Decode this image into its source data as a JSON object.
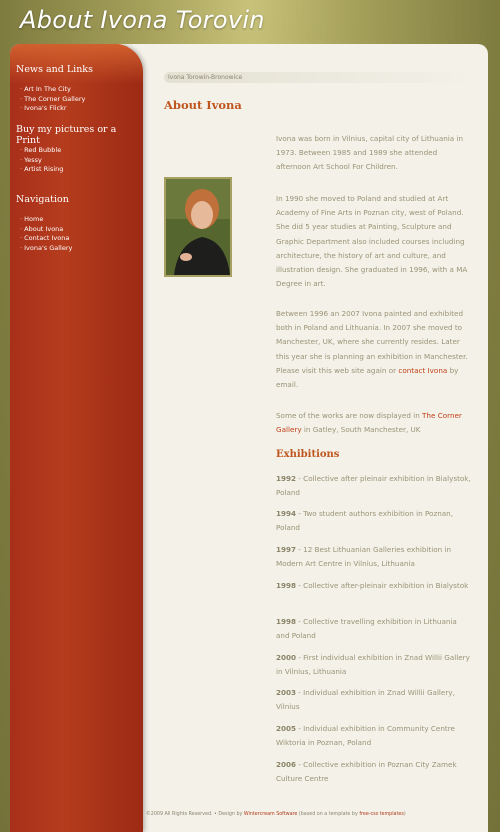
{
  "site": {
    "title": "About Ivona Torovin"
  },
  "sidebar": {
    "news_heading": "News and Links",
    "news_items": [
      {
        "label": "Art In The City"
      },
      {
        "label": "The Corner Gallery"
      },
      {
        "label": "Ivona's Flickr"
      }
    ],
    "buy_heading": "Buy my pictures or a Print",
    "buy_items": [
      {
        "label": "Red Bubble"
      },
      {
        "label": "Yessy"
      },
      {
        "label": "Artist Rising"
      }
    ],
    "nav_heading": "Navigation",
    "nav_items": [
      {
        "label": "Home"
      },
      {
        "label": "About Ivona"
      },
      {
        "label": "Contact Ivona"
      },
      {
        "label": "Ivona's Gallery"
      }
    ]
  },
  "main": {
    "breadcrumb": "Ivona Torowin-Bronowice",
    "heading": "About Ivona",
    "photo_alt": "Portrait photo of Ivona",
    "para1": "Ivona was born in Vilnius, capital city of Lithuania in 1973. Between 1985 and 1989 she attended afternoon Art School For Children.",
    "para2": "In 1990 she moved to Poland and studied at Art Academy of Fine Arts in Poznan city, west of Poland. She did 5 year studies at Painting, Sculpture and Graphic Department also included courses including architecture, the history of art and culture, and illustration design. She graduated in 1996, with a MA Degree in art.",
    "para3_before": "Between 1996 an 2007 Ivona painted and exhibited both in Poland and Lithuania. In 2007 she moved to Manchester, UK, where she currently resides. Later this year she is planning an exhibition in Manchester. Please visit this web site again or ",
    "para3_link": "contact Ivona",
    "para3_after": " by email.",
    "para4_before": "Some of the works are now displayed in ",
    "para4_link": "The Corner Gallery",
    "para4_after": " in Gatley, South Manchester, UK",
    "exhibitions_heading": "Exhibitions",
    "exhibitions": [
      {
        "year": "1992",
        "text": " - Collective after pleinair exhibition in Bialystok, Poland"
      },
      {
        "year": "1994",
        "text": " - Two student authors exhibition in Poznan, Poland"
      },
      {
        "year": "1997",
        "text": " - 12 Best Lithuanian Galleries exhibition in Modern Art Centre in Vilnius, Lithuania"
      },
      {
        "year": "1998",
        "text": " - Collective after-pleinair exhibition in Bialystok"
      },
      {
        "year": "1998",
        "text": " - Collective travelling exhibition in Lithuania and Poland"
      },
      {
        "year": "2000",
        "text": " - First individual exhibition in Znad Willii Gallery in Vilnius, Lithuania"
      },
      {
        "year": "2003",
        "text": " - Individual exhibition in Znad Willii Gallery, Vilnius"
      },
      {
        "year": "2005",
        "text": " - Individual exhibition in Community Centre Wiktoria in Poznan, Poland"
      },
      {
        "year": "2006",
        "text": " - Collective exhibition in Poznan City Zamek Culture Centre"
      }
    ]
  },
  "footer": {
    "copyright": "©2009 All Rights Reserved.",
    "sep": " • ",
    "design_by": "Design by ",
    "design_link": "Wintercream Software",
    "based_on": " (based on a template by ",
    "template_link": "free-css templates",
    "close": ")"
  },
  "colors": {
    "background": "#8c8a4a",
    "sidebar": "#b53c1d",
    "content_bg": "#f3f1e8",
    "heading": "#c0561f",
    "link": "#c0401a",
    "body_text": "#9a9477"
  }
}
